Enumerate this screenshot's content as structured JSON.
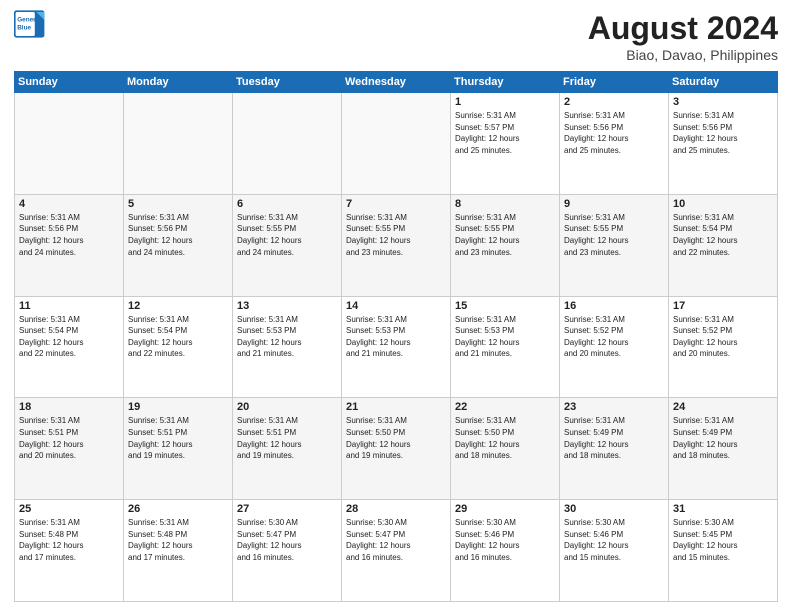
{
  "logo": {
    "line1": "General",
    "line2": "Blue"
  },
  "title": "August 2024",
  "subtitle": "Biao, Davao, Philippines",
  "weekdays": [
    "Sunday",
    "Monday",
    "Tuesday",
    "Wednesday",
    "Thursday",
    "Friday",
    "Saturday"
  ],
  "weeks": [
    [
      {
        "num": "",
        "info": ""
      },
      {
        "num": "",
        "info": ""
      },
      {
        "num": "",
        "info": ""
      },
      {
        "num": "",
        "info": ""
      },
      {
        "num": "1",
        "info": "Sunrise: 5:31 AM\nSunset: 5:57 PM\nDaylight: 12 hours\nand 25 minutes."
      },
      {
        "num": "2",
        "info": "Sunrise: 5:31 AM\nSunset: 5:56 PM\nDaylight: 12 hours\nand 25 minutes."
      },
      {
        "num": "3",
        "info": "Sunrise: 5:31 AM\nSunset: 5:56 PM\nDaylight: 12 hours\nand 25 minutes."
      }
    ],
    [
      {
        "num": "4",
        "info": "Sunrise: 5:31 AM\nSunset: 5:56 PM\nDaylight: 12 hours\nand 24 minutes."
      },
      {
        "num": "5",
        "info": "Sunrise: 5:31 AM\nSunset: 5:56 PM\nDaylight: 12 hours\nand 24 minutes."
      },
      {
        "num": "6",
        "info": "Sunrise: 5:31 AM\nSunset: 5:55 PM\nDaylight: 12 hours\nand 24 minutes."
      },
      {
        "num": "7",
        "info": "Sunrise: 5:31 AM\nSunset: 5:55 PM\nDaylight: 12 hours\nand 23 minutes."
      },
      {
        "num": "8",
        "info": "Sunrise: 5:31 AM\nSunset: 5:55 PM\nDaylight: 12 hours\nand 23 minutes."
      },
      {
        "num": "9",
        "info": "Sunrise: 5:31 AM\nSunset: 5:55 PM\nDaylight: 12 hours\nand 23 minutes."
      },
      {
        "num": "10",
        "info": "Sunrise: 5:31 AM\nSunset: 5:54 PM\nDaylight: 12 hours\nand 22 minutes."
      }
    ],
    [
      {
        "num": "11",
        "info": "Sunrise: 5:31 AM\nSunset: 5:54 PM\nDaylight: 12 hours\nand 22 minutes."
      },
      {
        "num": "12",
        "info": "Sunrise: 5:31 AM\nSunset: 5:54 PM\nDaylight: 12 hours\nand 22 minutes."
      },
      {
        "num": "13",
        "info": "Sunrise: 5:31 AM\nSunset: 5:53 PM\nDaylight: 12 hours\nand 21 minutes."
      },
      {
        "num": "14",
        "info": "Sunrise: 5:31 AM\nSunset: 5:53 PM\nDaylight: 12 hours\nand 21 minutes."
      },
      {
        "num": "15",
        "info": "Sunrise: 5:31 AM\nSunset: 5:53 PM\nDaylight: 12 hours\nand 21 minutes."
      },
      {
        "num": "16",
        "info": "Sunrise: 5:31 AM\nSunset: 5:52 PM\nDaylight: 12 hours\nand 20 minutes."
      },
      {
        "num": "17",
        "info": "Sunrise: 5:31 AM\nSunset: 5:52 PM\nDaylight: 12 hours\nand 20 minutes."
      }
    ],
    [
      {
        "num": "18",
        "info": "Sunrise: 5:31 AM\nSunset: 5:51 PM\nDaylight: 12 hours\nand 20 minutes."
      },
      {
        "num": "19",
        "info": "Sunrise: 5:31 AM\nSunset: 5:51 PM\nDaylight: 12 hours\nand 19 minutes."
      },
      {
        "num": "20",
        "info": "Sunrise: 5:31 AM\nSunset: 5:51 PM\nDaylight: 12 hours\nand 19 minutes."
      },
      {
        "num": "21",
        "info": "Sunrise: 5:31 AM\nSunset: 5:50 PM\nDaylight: 12 hours\nand 19 minutes."
      },
      {
        "num": "22",
        "info": "Sunrise: 5:31 AM\nSunset: 5:50 PM\nDaylight: 12 hours\nand 18 minutes."
      },
      {
        "num": "23",
        "info": "Sunrise: 5:31 AM\nSunset: 5:49 PM\nDaylight: 12 hours\nand 18 minutes."
      },
      {
        "num": "24",
        "info": "Sunrise: 5:31 AM\nSunset: 5:49 PM\nDaylight: 12 hours\nand 18 minutes."
      }
    ],
    [
      {
        "num": "25",
        "info": "Sunrise: 5:31 AM\nSunset: 5:48 PM\nDaylight: 12 hours\nand 17 minutes."
      },
      {
        "num": "26",
        "info": "Sunrise: 5:31 AM\nSunset: 5:48 PM\nDaylight: 12 hours\nand 17 minutes."
      },
      {
        "num": "27",
        "info": "Sunrise: 5:30 AM\nSunset: 5:47 PM\nDaylight: 12 hours\nand 16 minutes."
      },
      {
        "num": "28",
        "info": "Sunrise: 5:30 AM\nSunset: 5:47 PM\nDaylight: 12 hours\nand 16 minutes."
      },
      {
        "num": "29",
        "info": "Sunrise: 5:30 AM\nSunset: 5:46 PM\nDaylight: 12 hours\nand 16 minutes."
      },
      {
        "num": "30",
        "info": "Sunrise: 5:30 AM\nSunset: 5:46 PM\nDaylight: 12 hours\nand 15 minutes."
      },
      {
        "num": "31",
        "info": "Sunrise: 5:30 AM\nSunset: 5:45 PM\nDaylight: 12 hours\nand 15 minutes."
      }
    ]
  ]
}
